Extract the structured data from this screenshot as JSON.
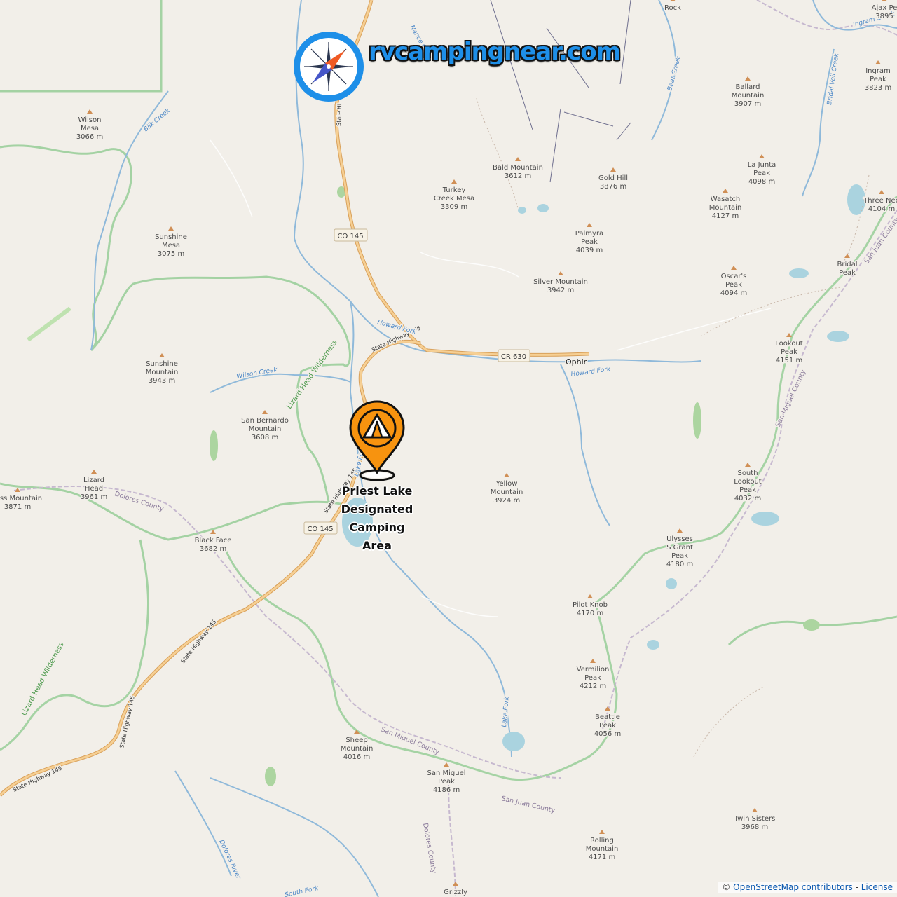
{
  "brand": {
    "text": "rvcampingnear.com",
    "icon": "compass-icon"
  },
  "poi": {
    "label": "Priest Lake Designated Camping Area",
    "icon": "camping-tent-pin-icon",
    "color": "#f7930f"
  },
  "attribution": {
    "prefix": "©",
    "osm_link": "OpenStreetMap contributors",
    "separator": " - ",
    "license_link": "License"
  },
  "colors": {
    "land": "#f2efe9",
    "water": "#aad3df",
    "river": "#8fb9da",
    "road": "#e8b56d",
    "boundary_green": "#8fc98f",
    "boundary_admin": "#b9a7c4"
  },
  "peaks": [
    {
      "name": "Wilson",
      "name2": "Mesa",
      "elev": "3066 m"
    },
    {
      "name": "Sunshine",
      "name2": "Mesa",
      "elev": "3075 m"
    },
    {
      "name": "Sunshine",
      "name2": "Mountain",
      "elev": "3943 m"
    },
    {
      "name": "San Bernardo",
      "name2": "Mountain",
      "elev": "3608 m"
    },
    {
      "name": "Lizard",
      "name2": "Head",
      "elev": "3961 m"
    },
    {
      "name": "ross Mountain",
      "name2": "",
      "elev": "3871 m"
    },
    {
      "name": "Black Face",
      "name2": "",
      "elev": "3682 m"
    },
    {
      "name": "Turkey",
      "name2": "Creek Mesa",
      "elev": "3309 m"
    },
    {
      "name": "Bald Mountain",
      "name2": "",
      "elev": "3612 m"
    },
    {
      "name": "Gold Hill",
      "name2": "",
      "elev": "3876 m"
    },
    {
      "name": "Ballard",
      "name2": "Mountain",
      "elev": "3907 m"
    },
    {
      "name": "La Junta",
      "name2": "Peak",
      "elev": "4098 m"
    },
    {
      "name": "Ingram",
      "name2": "Peak",
      "elev": "3823 m"
    },
    {
      "name": "Wasatch",
      "name2": "Mountain",
      "elev": "4127 m"
    },
    {
      "name": "Palmyra",
      "name2": "Peak",
      "elev": "4039 m"
    },
    {
      "name": "Silver Mountain",
      "name2": "",
      "elev": "3942 m"
    },
    {
      "name": "Oscar's",
      "name2": "Peak",
      "elev": "4094 m"
    },
    {
      "name": "Bridal",
      "name2": "Peak",
      "elev": ""
    },
    {
      "name": "Three Nee",
      "name2": "",
      "elev": "4104 m"
    },
    {
      "name": "Lookout",
      "name2": "Peak",
      "elev": "4151 m"
    },
    {
      "name": "Yellow",
      "name2": "Mountain",
      "elev": "3924 m"
    },
    {
      "name": "South",
      "name2": "Lookout",
      "name3": "Peak",
      "elev": "4032 m"
    },
    {
      "name": "Ulysses",
      "name2": "S Grant",
      "name3": "Peak",
      "elev": "4180 m"
    },
    {
      "name": "Pilot Knob",
      "name2": "",
      "elev": "4170 m"
    },
    {
      "name": "Vermilion",
      "name2": "Peak",
      "elev": "4212 m"
    },
    {
      "name": "Beattie",
      "name2": "Peak",
      "elev": "4056 m"
    },
    {
      "name": "Sheep",
      "name2": "Mountain",
      "elev": "4016 m"
    },
    {
      "name": "San Miguel",
      "name2": "Peak",
      "elev": "4186 m"
    },
    {
      "name": "Twin Sisters",
      "name2": "",
      "elev": "3968 m"
    },
    {
      "name": "Rolling",
      "name2": "Mountain",
      "elev": "4171 m"
    },
    {
      "name": "Grizzly",
      "name2": "",
      "elev": ""
    },
    {
      "name": "Ajax Pe",
      "name2": "3895",
      "elev": ""
    },
    {
      "name": "Rock",
      "name2": "",
      "elev": ""
    }
  ],
  "roads": {
    "co145_a": "CO 145",
    "co145_b": "CO 145",
    "cr630": "CR 630",
    "sh145_1": "State Highway 145",
    "sh145_2": "State Highway 145",
    "sh145_3": "State Highway 145",
    "sh145_4": "State Highway 145",
    "sh145_5": "State Highway 145",
    "sh145_top": "State Hi"
  },
  "places": {
    "ophir": "Ophir"
  },
  "water_labels": {
    "bilk_creek": "Bilk Creek",
    "wilson_creek": "Wilson Creek",
    "howard_fork_1": "Howard Fork",
    "howard_fork_2": "Howard Fork",
    "lake_fork": "Lake Fork",
    "dolores_river": "Dolores River",
    "south_fork": "South Fork",
    "bear_creek": "Bear Creek",
    "bridal_veil_creek": "Bridal Veil Creek",
    "ingram_creek": "Ingram Creek",
    "lake_fork_2": "Lake Fork",
    "nance_creek": "Nance C"
  },
  "boundary_labels": {
    "lizard_head_wilderness_1": "Lizard Head Wilderness",
    "lizard_head_wilderness_2": "Lizard Head Wilderness",
    "dolores_county_1": "Dolores County",
    "dolores_county_2": "Dolores County",
    "san_miguel_county_1": "San Miguel County",
    "san_miguel_county_2": "San Miguel County",
    "san_juan_county_1": "San Juan County",
    "san_juan_county_2": "San Juan County"
  }
}
